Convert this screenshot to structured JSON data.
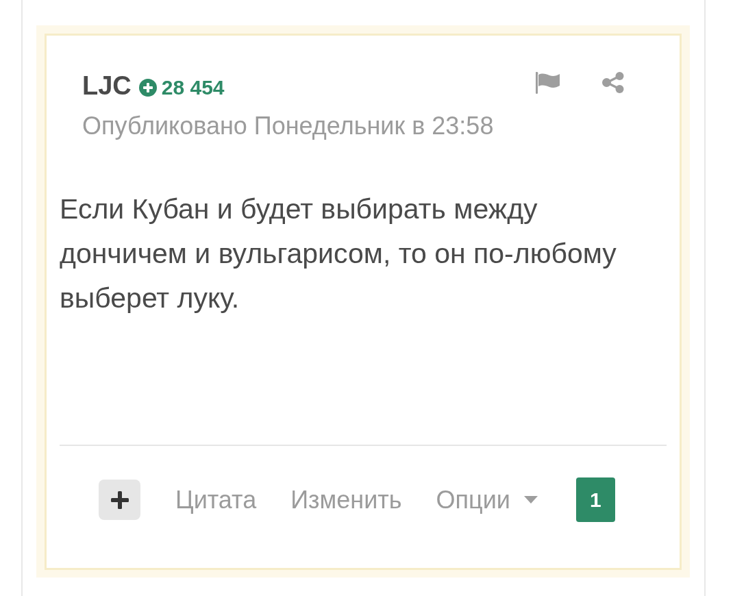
{
  "post": {
    "author": "LJC",
    "reputation": "28 454",
    "published": "Опубликовано Понедельник в 23:58",
    "body": "Если Кубан и будет выбирать между дончичем и вульгарисом, то он по-любому выберет луку."
  },
  "footer": {
    "actions": [
      {
        "kind": "link",
        "label": "Цитата"
      },
      {
        "kind": "link",
        "label": "Изменить"
      },
      {
        "kind": "dropdown",
        "label": "Опции"
      }
    ],
    "reaction_count": "1"
  }
}
